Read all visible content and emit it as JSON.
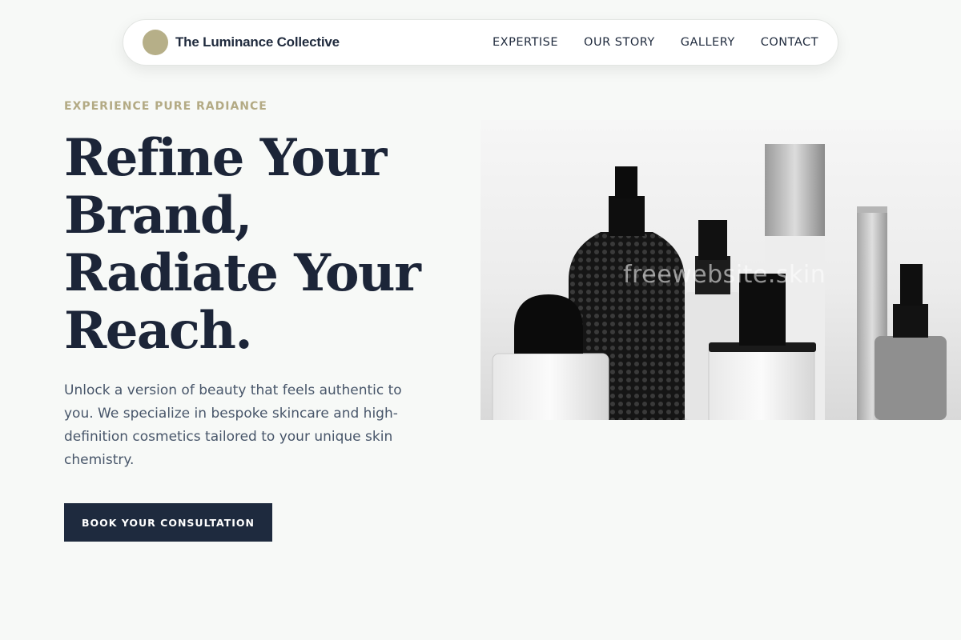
{
  "header": {
    "brand_name": "The Luminance Collective",
    "brand_color": "#b6af88",
    "nav": [
      {
        "label": "EXPERTISE"
      },
      {
        "label": "OUR STORY"
      },
      {
        "label": "GALLERY"
      },
      {
        "label": "CONTACT"
      }
    ]
  },
  "hero": {
    "eyebrow": "EXPERIENCE PURE RADIANCE",
    "headline": "Refine Your Brand, Radiate Your Reach.",
    "lead": "Unlock a version of beauty that feels authentic to you. We specialize in bespoke skincare and high-definition cosmetics tailored to your unique skin chemistry.",
    "cta_label": "BOOK YOUR CONSULTATION",
    "image_watermark": "freewebsite.skin"
  },
  "colors": {
    "background": "#f7f9f7",
    "navy": "#1e2a3e",
    "accent": "#b3aa84",
    "body_text": "#48566a"
  }
}
